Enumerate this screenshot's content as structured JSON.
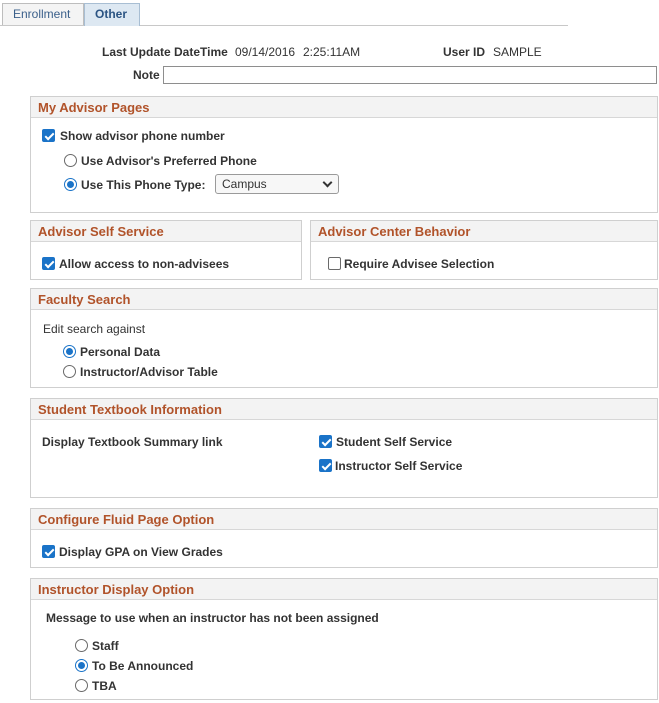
{
  "tabs": [
    {
      "label": "Enrollment",
      "active": false
    },
    {
      "label": "Other",
      "active": true
    }
  ],
  "header": {
    "last_update_label": "Last Update DateTime",
    "last_update_date": "09/14/2016",
    "last_update_time": "2:25:11AM",
    "user_id_label": "User ID",
    "user_id_value": "SAMPLE",
    "note_label": "Note",
    "note_value": ""
  },
  "advisor_pages": {
    "title": "My Advisor Pages",
    "show_phone_label": "Show advisor phone number",
    "show_phone_checked": true,
    "preferred_phone_label": "Use Advisor's Preferred Phone",
    "preferred_phone_selected": false,
    "phone_type_label": "Use This Phone Type:",
    "phone_type_selected": true,
    "phone_type_value": "Campus"
  },
  "advisor_self_service": {
    "title": "Advisor Self Service",
    "allow_label": "Allow access to non-advisees",
    "allow_checked": true
  },
  "advisor_center": {
    "title": "Advisor Center Behavior",
    "require_label": "Require Advisee Selection",
    "require_checked": false
  },
  "faculty_search": {
    "title": "Faculty Search",
    "edit_label": "Edit search against",
    "options": [
      {
        "label": "Personal Data",
        "selected": true
      },
      {
        "label": "Instructor/Advisor Table",
        "selected": false
      }
    ]
  },
  "textbook": {
    "title": "Student Textbook Information",
    "display_label": "Display Textbook Summary link",
    "student_label": "Student Self Service",
    "student_checked": true,
    "instructor_label": "Instructor Self Service",
    "instructor_checked": true
  },
  "fluid": {
    "title": "Configure Fluid Page Option",
    "gpa_label": "Display GPA on View Grades",
    "gpa_checked": true
  },
  "instructor_display": {
    "title": "Instructor Display Option",
    "message_label": "Message to use when an instructor has not been assigned",
    "options": [
      {
        "label": "Staff",
        "selected": false
      },
      {
        "label": "To Be Announced",
        "selected": true
      },
      {
        "label": "TBA",
        "selected": false
      }
    ]
  },
  "colors": {
    "accent": "#1a73c8",
    "section_title": "#b1532a",
    "tab_text": "#3a5f8a"
  }
}
